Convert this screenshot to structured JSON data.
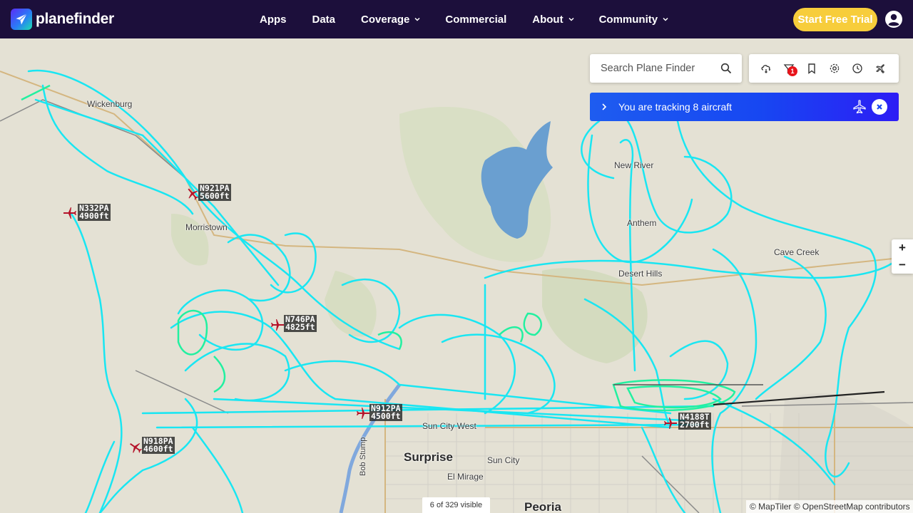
{
  "brand": {
    "name": "planefinder"
  },
  "nav": {
    "items": [
      {
        "label": "Apps",
        "dropdown": false
      },
      {
        "label": "Data",
        "dropdown": false
      },
      {
        "label": "Coverage",
        "dropdown": true
      },
      {
        "label": "Commercial",
        "dropdown": false
      },
      {
        "label": "About",
        "dropdown": true
      },
      {
        "label": "Community",
        "dropdown": true
      }
    ],
    "cta": "Start Free Trial"
  },
  "search": {
    "placeholder": "Search Plane Finder"
  },
  "toolbar": {
    "tools": [
      "weather-icon",
      "filter-icon",
      "bookmark-icon",
      "settings-icon",
      "history-icon",
      "airport-icon"
    ],
    "filter_badge": "1"
  },
  "tracking": {
    "text": "You are tracking 8 aircraft"
  },
  "zoom": {
    "in": "+",
    "out": "−"
  },
  "status": {
    "visible": "6 of 329 visible"
  },
  "attribution": "© MapTiler © OpenStreetMap contributors",
  "places": [
    {
      "name": "Wickenburg"
    },
    {
      "name": "New River"
    },
    {
      "name": "Anthem"
    },
    {
      "name": "Desert Hills"
    },
    {
      "name": "Cave Creek"
    },
    {
      "name": "Morristown"
    },
    {
      "name": "Surprise"
    },
    {
      "name": "Sun City"
    },
    {
      "name": "Sun City West"
    },
    {
      "name": "El Mirage"
    },
    {
      "name": "Peoria"
    },
    {
      "name": "Bob Stump"
    }
  ],
  "aircraft": [
    {
      "callsign": "N921PA",
      "altitude": "5600ft"
    },
    {
      "callsign": "N332PA",
      "altitude": "4900ft"
    },
    {
      "callsign": "N746PA",
      "altitude": "4825ft"
    },
    {
      "callsign": "N912PA",
      "altitude": "4500ft"
    },
    {
      "callsign": "N918PA",
      "altitude": "4600ft"
    },
    {
      "callsign": "N4188T",
      "altitude": "2700ft"
    }
  ],
  "colors": {
    "navbar": "#1c0f3b",
    "cta": "#f7cd3b",
    "track": "#19e6f2",
    "track_low": "#22f0a0",
    "tracking_bar": "#1747f2",
    "plane": "#b5132a",
    "water": "#6a9fd0"
  }
}
